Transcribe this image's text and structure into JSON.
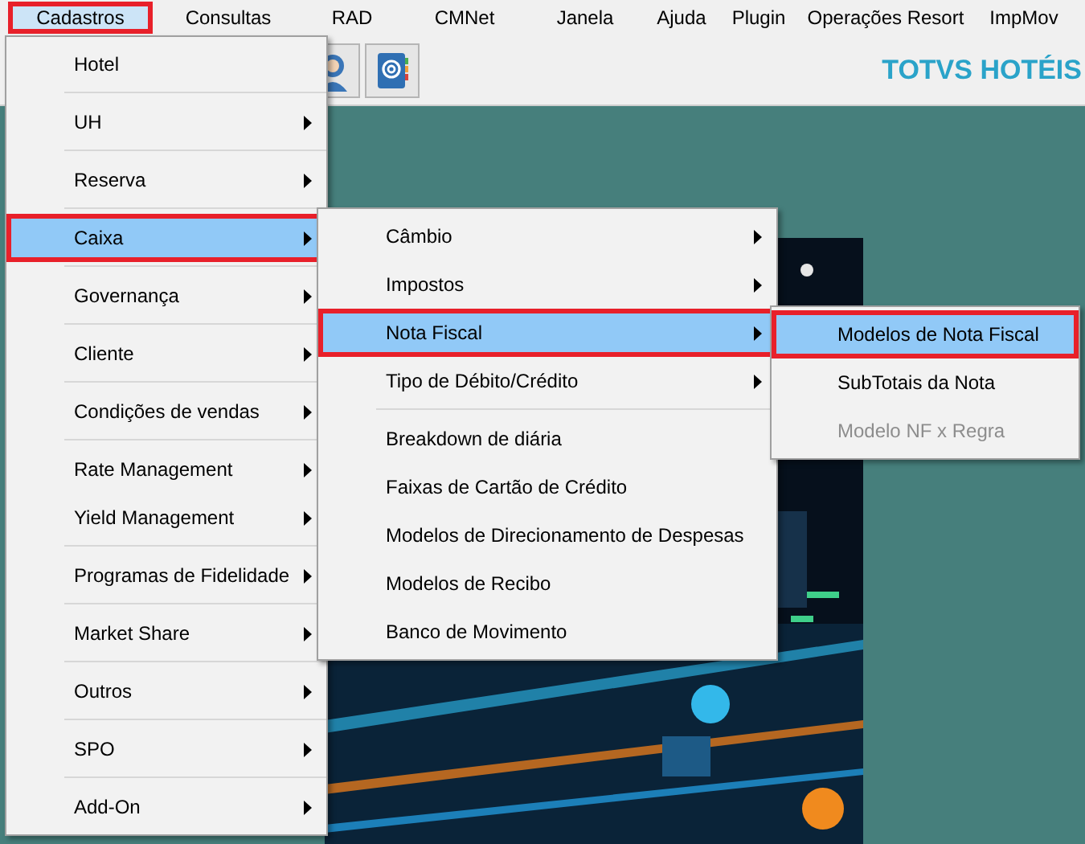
{
  "menubar": [
    {
      "label": "Cadastros",
      "selected": true,
      "outlined": true
    },
    {
      "label": "Consultas",
      "selected": false,
      "outlined": false
    },
    {
      "label": "RAD",
      "selected": false,
      "outlined": false
    },
    {
      "label": "CMNet",
      "selected": false,
      "outlined": false
    },
    {
      "label": "Janela",
      "selected": false,
      "outlined": false
    },
    {
      "label": "Ajuda",
      "selected": false,
      "outlined": false
    },
    {
      "label": "Plugin",
      "selected": false,
      "outlined": false
    },
    {
      "label": "Operações Resort",
      "selected": false,
      "outlined": false
    },
    {
      "label": "ImpMov",
      "selected": false,
      "outlined": false
    }
  ],
  "brand": "TOTVS HOTÉIS",
  "menus": [
    {
      "groups": [
        [
          {
            "label": "Hotel",
            "submenu": false,
            "selected": false,
            "outlined": false,
            "disabled": false
          }
        ],
        [
          {
            "label": "UH",
            "submenu": true,
            "selected": false,
            "outlined": false,
            "disabled": false
          }
        ],
        [
          {
            "label": "Reserva",
            "submenu": true,
            "selected": false,
            "outlined": false,
            "disabled": false
          }
        ],
        [
          {
            "label": "Caixa",
            "submenu": true,
            "selected": true,
            "outlined": true,
            "disabled": false
          }
        ],
        [
          {
            "label": "Governança",
            "submenu": true,
            "selected": false,
            "outlined": false,
            "disabled": false
          }
        ],
        [
          {
            "label": "Cliente",
            "submenu": true,
            "selected": false,
            "outlined": false,
            "disabled": false
          }
        ],
        [
          {
            "label": "Condições de vendas",
            "submenu": true,
            "selected": false,
            "outlined": false,
            "disabled": false
          }
        ],
        [
          {
            "label": "Rate Management",
            "submenu": true,
            "selected": false,
            "outlined": false,
            "disabled": false
          },
          {
            "label": "Yield Management",
            "submenu": true,
            "selected": false,
            "outlined": false,
            "disabled": false
          }
        ],
        [
          {
            "label": "Programas de Fidelidade",
            "submenu": true,
            "selected": false,
            "outlined": false,
            "disabled": false
          }
        ],
        [
          {
            "label": "Market Share",
            "submenu": true,
            "selected": false,
            "outlined": false,
            "disabled": false
          }
        ],
        [
          {
            "label": "Outros",
            "submenu": true,
            "selected": false,
            "outlined": false,
            "disabled": false
          }
        ],
        [
          {
            "label": "SPO",
            "submenu": true,
            "selected": false,
            "outlined": false,
            "disabled": false
          }
        ],
        [
          {
            "label": "Add-On",
            "submenu": true,
            "selected": false,
            "outlined": false,
            "disabled": false
          }
        ]
      ]
    },
    {
      "groups": [
        [
          {
            "label": "Câmbio",
            "submenu": true,
            "selected": false,
            "outlined": false,
            "disabled": false
          },
          {
            "label": "Impostos",
            "submenu": true,
            "selected": false,
            "outlined": false,
            "disabled": false
          },
          {
            "label": "Nota Fiscal",
            "submenu": true,
            "selected": true,
            "outlined": true,
            "disabled": false
          },
          {
            "label": "Tipo de Débito/Crédito",
            "submenu": true,
            "selected": false,
            "outlined": false,
            "disabled": false
          }
        ],
        [
          {
            "label": "Breakdown de diária",
            "submenu": false,
            "selected": false,
            "outlined": false,
            "disabled": false
          },
          {
            "label": "Faixas de Cartão de Crédito",
            "submenu": false,
            "selected": false,
            "outlined": false,
            "disabled": false
          },
          {
            "label": "Modelos de Direcionamento de Despesas",
            "submenu": false,
            "selected": false,
            "outlined": false,
            "disabled": false
          },
          {
            "label": "Modelos de Recibo",
            "submenu": false,
            "selected": false,
            "outlined": false,
            "disabled": false
          },
          {
            "label": "Banco de Movimento",
            "submenu": false,
            "selected": false,
            "outlined": false,
            "disabled": false
          }
        ]
      ]
    },
    {
      "groups": [
        [
          {
            "label": "Modelos de Nota Fiscal",
            "submenu": false,
            "selected": true,
            "outlined": true,
            "disabled": false
          },
          {
            "label": "SubTotais da Nota",
            "submenu": false,
            "selected": false,
            "outlined": false,
            "disabled": false
          },
          {
            "label": "Modelo NF x Regra",
            "submenu": false,
            "selected": false,
            "outlined": false,
            "disabled": true
          }
        ]
      ]
    }
  ]
}
